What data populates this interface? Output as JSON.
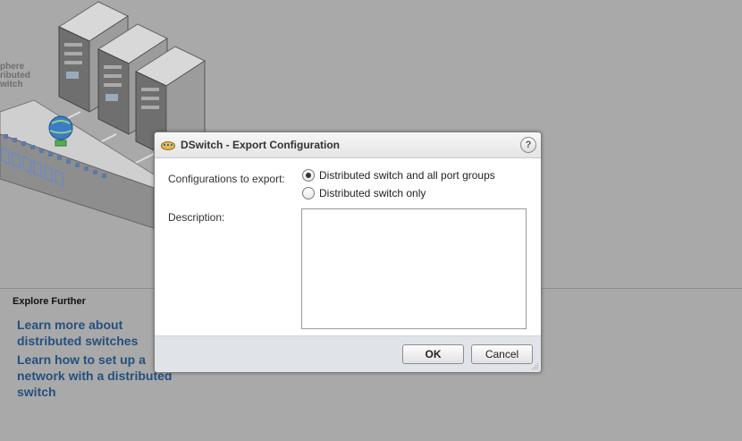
{
  "background": {
    "vds_label_lines": [
      "phere",
      "ributed",
      "witch"
    ],
    "explore": {
      "title": "Explore Further",
      "link1": "Learn more about distributed switches",
      "link2": "Learn how to set up a network with a distributed switch"
    }
  },
  "dialog": {
    "title": "DSwitch - Export Configuration",
    "help_glyph": "?",
    "export_label": "Configurations to export:",
    "options": [
      {
        "label": "Distributed switch and all port groups",
        "selected": true
      },
      {
        "label": "Distributed switch only",
        "selected": false
      }
    ],
    "description_label": "Description:",
    "description_value": "",
    "ok_label": "OK",
    "cancel_label": "Cancel"
  },
  "colors": {
    "backdrop": "#a9a9a9",
    "link": "#25507e",
    "footer": "#e0e3e7"
  },
  "icons": [
    "vds-switch-icon",
    "help-icon",
    "radio-selected-icon",
    "resize-grip-icon"
  ]
}
